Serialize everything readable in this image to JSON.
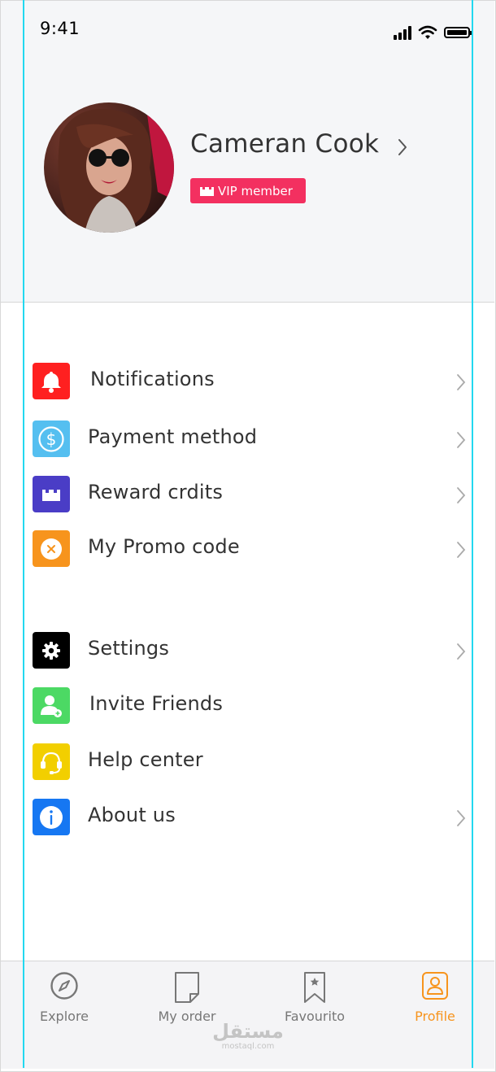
{
  "status_bar": {
    "time": "9:41"
  },
  "profile": {
    "name": "Cameran Cook",
    "badge": "VIP member"
  },
  "menu": {
    "group1": [
      {
        "label": "Notifications",
        "icon": "bell-icon",
        "color": "#ff2020"
      },
      {
        "label": "Payment method",
        "icon": "dollar-icon",
        "color": "#55bff0"
      },
      {
        "label": "Reward crdits",
        "icon": "castle-icon",
        "color": "#4a3dc6"
      },
      {
        "label": "My Promo code",
        "icon": "close-circle-icon",
        "color": "#f7941d"
      }
    ],
    "group2": [
      {
        "label": "Settings",
        "icon": "gear-icon",
        "color": "#000000"
      },
      {
        "label": "Invite Friends",
        "icon": "add-user-icon",
        "color": "#4cd964"
      },
      {
        "label": "Help center",
        "icon": "headset-icon",
        "color": "#f2cf00"
      },
      {
        "label": "About us",
        "icon": "info-icon",
        "color": "#1677f2"
      }
    ]
  },
  "tabs": [
    {
      "label": "Explore",
      "icon": "compass-icon"
    },
    {
      "label": "My order",
      "icon": "order-sheet-icon"
    },
    {
      "label": "Favourito",
      "icon": "bookmark-star-icon"
    },
    {
      "label": "Profile",
      "icon": "profile-icon",
      "active": true
    }
  ],
  "theme": {
    "accent": "#f7941d",
    "vip_color": "#f33060",
    "guide_color": "#22d8f0"
  },
  "watermark": {
    "main": "مستقل",
    "sub": "mostaql.com"
  }
}
